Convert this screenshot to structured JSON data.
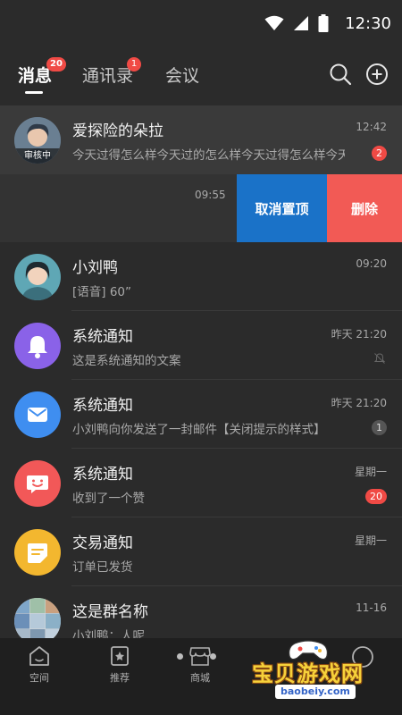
{
  "status_bar": {
    "time": "12:30"
  },
  "header": {
    "tabs": [
      {
        "label": "消息",
        "badge": "20",
        "active": true
      },
      {
        "label": "通讯录",
        "badge": "1",
        "active": false
      },
      {
        "label": "会议",
        "badge": "",
        "active": false
      }
    ]
  },
  "conversations": [
    {
      "title": "爱探险的朵拉",
      "subtitle": "今天过得怎么样今天过的怎么样今天过得怎么样今天",
      "time": "12:42",
      "badge": "2",
      "avatar_tag": "审核中"
    },
    {
      "title": "小刘鸭",
      "subtitle": "[语音] 60”",
      "time": "09:20",
      "badge": ""
    },
    {
      "title": "系统通知",
      "subtitle": "这是系统通知的文案",
      "time": "昨天 21:20",
      "badge": ""
    },
    {
      "title": "系统通知",
      "subtitle": "小刘鸭向你发送了一封邮件【关闭提示的样式】",
      "time": "昨天 21:20",
      "badge": "1"
    },
    {
      "title": "系统通知",
      "subtitle": "收到了一个赞",
      "time": "星期一",
      "badge": "20"
    },
    {
      "title": "交易通知",
      "subtitle": "订单已发货",
      "time": "星期一",
      "badge": ""
    },
    {
      "title": "这是群名称",
      "subtitle": "小刘鸭：人呢",
      "time": "11-16",
      "badge": ""
    }
  ],
  "swiped_row": {
    "time": "09:55",
    "unpin_label": "取消置顶",
    "delete_label": "删除"
  },
  "bottom_nav": [
    {
      "label": "空间"
    },
    {
      "label": "推荐"
    },
    {
      "label": "商城"
    }
  ],
  "watermark": {
    "title": "宝贝游戏网",
    "url": "baobeiy.com"
  },
  "colors": {
    "background": "#2b2b2b",
    "badge_red": "#f04a45",
    "unpin_blue": "#1a72c8",
    "delete_red": "#f25a55",
    "bell_purple": "#8a62e8",
    "mail_blue": "#3f8ef0",
    "chat_red": "#f25858",
    "trade_yellow": "#f3b72f"
  }
}
